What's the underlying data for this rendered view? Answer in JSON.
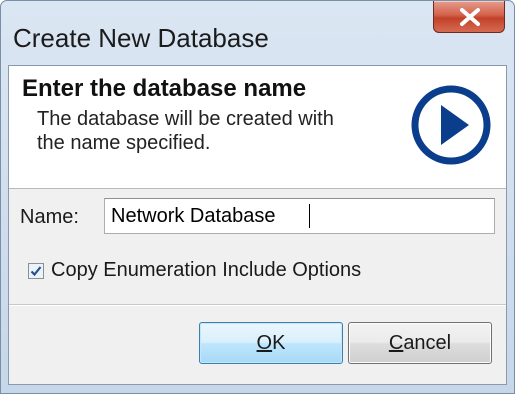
{
  "window": {
    "title": "Create New Database",
    "close_icon": "close-x-icon"
  },
  "header": {
    "title": "Enter the database name",
    "subtitle_line1": "The database will be created with",
    "subtitle_line2": "the name specified.",
    "icon": "play-circle-icon",
    "icon_color": "#0a3d8c"
  },
  "form": {
    "name_label": "Name:",
    "name_value": "Network Database",
    "copy_enum_label": "Copy Enumeration Include Options",
    "copy_enum_checked": true
  },
  "buttons": {
    "ok": {
      "mnemonic": "O",
      "rest": "K"
    },
    "cancel": {
      "mnemonic": "C",
      "rest": "ancel"
    }
  }
}
